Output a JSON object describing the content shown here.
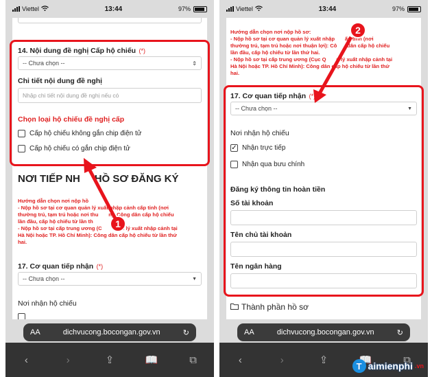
{
  "status": {
    "carrier": "Viettel",
    "time": "13:44",
    "battery": "97%"
  },
  "browser": {
    "aa": "AA",
    "url": "dichvucong.bocongan.gov.vn"
  },
  "left": {
    "field14_label": "14. Nội dung đề nghị Cấp hộ chiếu",
    "req_mark": "(*)",
    "select_placeholder": "-- Chưa chọn --",
    "detail_label": "Chi tiết nội dung đề nghị",
    "detail_placeholder": "Nhập chi tiết nội dung đề nghị nếu có",
    "passport_type_label": "Chọn loại hộ chiếu đề nghị cấp",
    "option_no_chip": "Cấp hộ chiếu không gắn chip điện tử",
    "option_chip": "Cấp hộ chiếu có gắn chip điện tử",
    "section_title": "NƠI TIẾP NH     HỒ SƠ ĐĂNG KÝ",
    "guide_lines": [
      "Hướng dẫn chọn nơi nộp hồ",
      "- Nộp hồ sơ tại cơ quan quản lý xuất nhập cảnh cấp tỉnh (nơi",
      "thường trú, tạm trú hoặc nơi thu       n): Công dân cấp hộ chiếu",
      "lần đầu, cấp hộ chiếu từ lần th",
      "- Nộp hồ sơ tại cấp trung ương (C       quản lý xuất nhập cảnh tại",
      "Hà Nội hoặc TP. Hồ Chí Minh): Công dân cấp hộ chiếu từ lần thứ",
      "hai."
    ],
    "field17_label": "17. Cơ quan tiếp nhận",
    "receive_label": "Nơi nhận hộ chiếu",
    "badge": "1"
  },
  "right": {
    "guide_lines": [
      "Hướng dẫn chọn nơi nộp hồ sơ:",
      "- Nộp hồ sơ tại cơ quan quản lý xuất nhập       ấp tỉnh (nơi",
      "thường trú, tạm trú hoặc nơi thuận lợi): Cô       dân cấp hộ chiếu",
      "lần đầu, cấp hộ chiếu từ lần thứ hai.",
      "- Nộp hồ sơ tại cấp trung ương (Cục Q       n lý xuất nhập cảnh tại",
      "Hà Nội hoặc TP. Hồ Chí Minh): Công dân cấp hộ chiếu từ lần thứ",
      "hai."
    ],
    "field17_label": "17. Cơ quan tiếp nhận",
    "req_mark": "(*)",
    "select_placeholder": "-- Chưa chọn --",
    "receive_label": "Nơi nhận hộ chiếu",
    "option_direct": "Nhận trực tiếp",
    "option_post": "Nhận qua bưu chính",
    "refund_label": "Đăng ký thông tin hoàn tiền",
    "account_no_label": "Số tài khoản",
    "account_name_label": "Tên chủ tài khoản",
    "bank_name_label": "Tên ngân hàng",
    "components_label": "Thành phần hồ sơ",
    "badge": "2"
  },
  "watermark": {
    "logo_letter": "T",
    "text": "aimienphi",
    "suffix": ".vn"
  },
  "colors": {
    "highlight": "#e8141c",
    "required": "#e02020"
  }
}
